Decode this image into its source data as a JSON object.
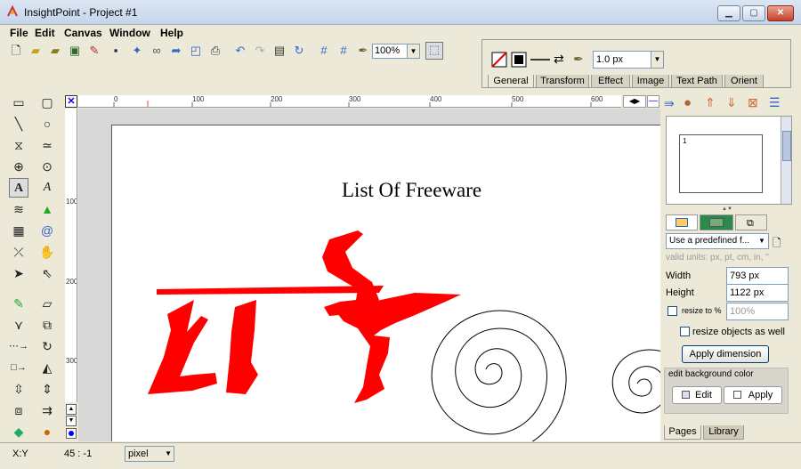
{
  "window": {
    "title": "InsightPoint - Project #1",
    "minimize": "▁",
    "maximize": "▢",
    "close": "✕"
  },
  "menu": [
    "File",
    "Edit",
    "Canvas",
    "Window",
    "Help"
  ],
  "toolbar": {
    "zoom_value": "100%"
  },
  "properties": {
    "stroke_width": "1.0 px",
    "tabs": [
      "General",
      "Transform",
      "Effect",
      "Image",
      "Text Path",
      "Orient"
    ],
    "active_tab": "General"
  },
  "ruler": {
    "h_labels": [
      "0",
      "100",
      "200",
      "300",
      "400",
      "500",
      "600"
    ],
    "v_labels": [
      "100",
      "200",
      "300"
    ]
  },
  "canvas": {
    "title": "List Of Freeware"
  },
  "pages": {
    "thumbnail_number": "1",
    "predefined_label": "Use a predefined f...",
    "units_hint": "valid units: px, pt, cm, in, \"",
    "width_label": "Width",
    "width_value": "793 px",
    "height_label": "Height",
    "height_value": "1122 px",
    "resize_label": "resize to %",
    "resize_value": "100%",
    "resize_objects_label": "resize objects as well",
    "apply_dimension": "Apply dimension",
    "bg_group_label": "edit background color",
    "edit_button": "Edit",
    "apply_button": "Apply",
    "bottom_tabs": [
      "Pages",
      "Library"
    ]
  },
  "status": {
    "coord_label": "X:Y",
    "coord_value": "45 : -1",
    "unit": "pixel"
  },
  "colors": {
    "accent_red": "#ff0000",
    "title_gradient": "#c5d5ea"
  }
}
